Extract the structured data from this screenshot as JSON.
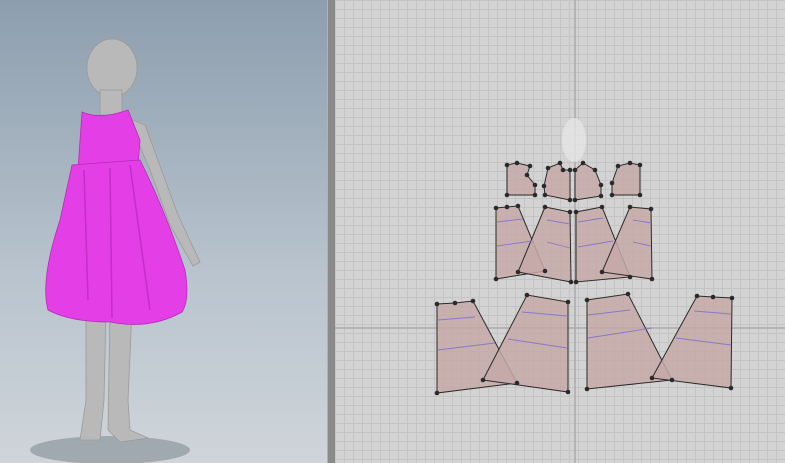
{
  "colors": {
    "dress": "#e43fe6",
    "avatar": "#b8b8b8",
    "pattern_fill": "#c6a9a8",
    "background_3d": "#a3b2c0",
    "grid": "#d3d3d3"
  },
  "icons": {
    "splitter": "splitter-grip-icon"
  },
  "views": [
    "3d-garment-view",
    "2d-pattern-view"
  ]
}
